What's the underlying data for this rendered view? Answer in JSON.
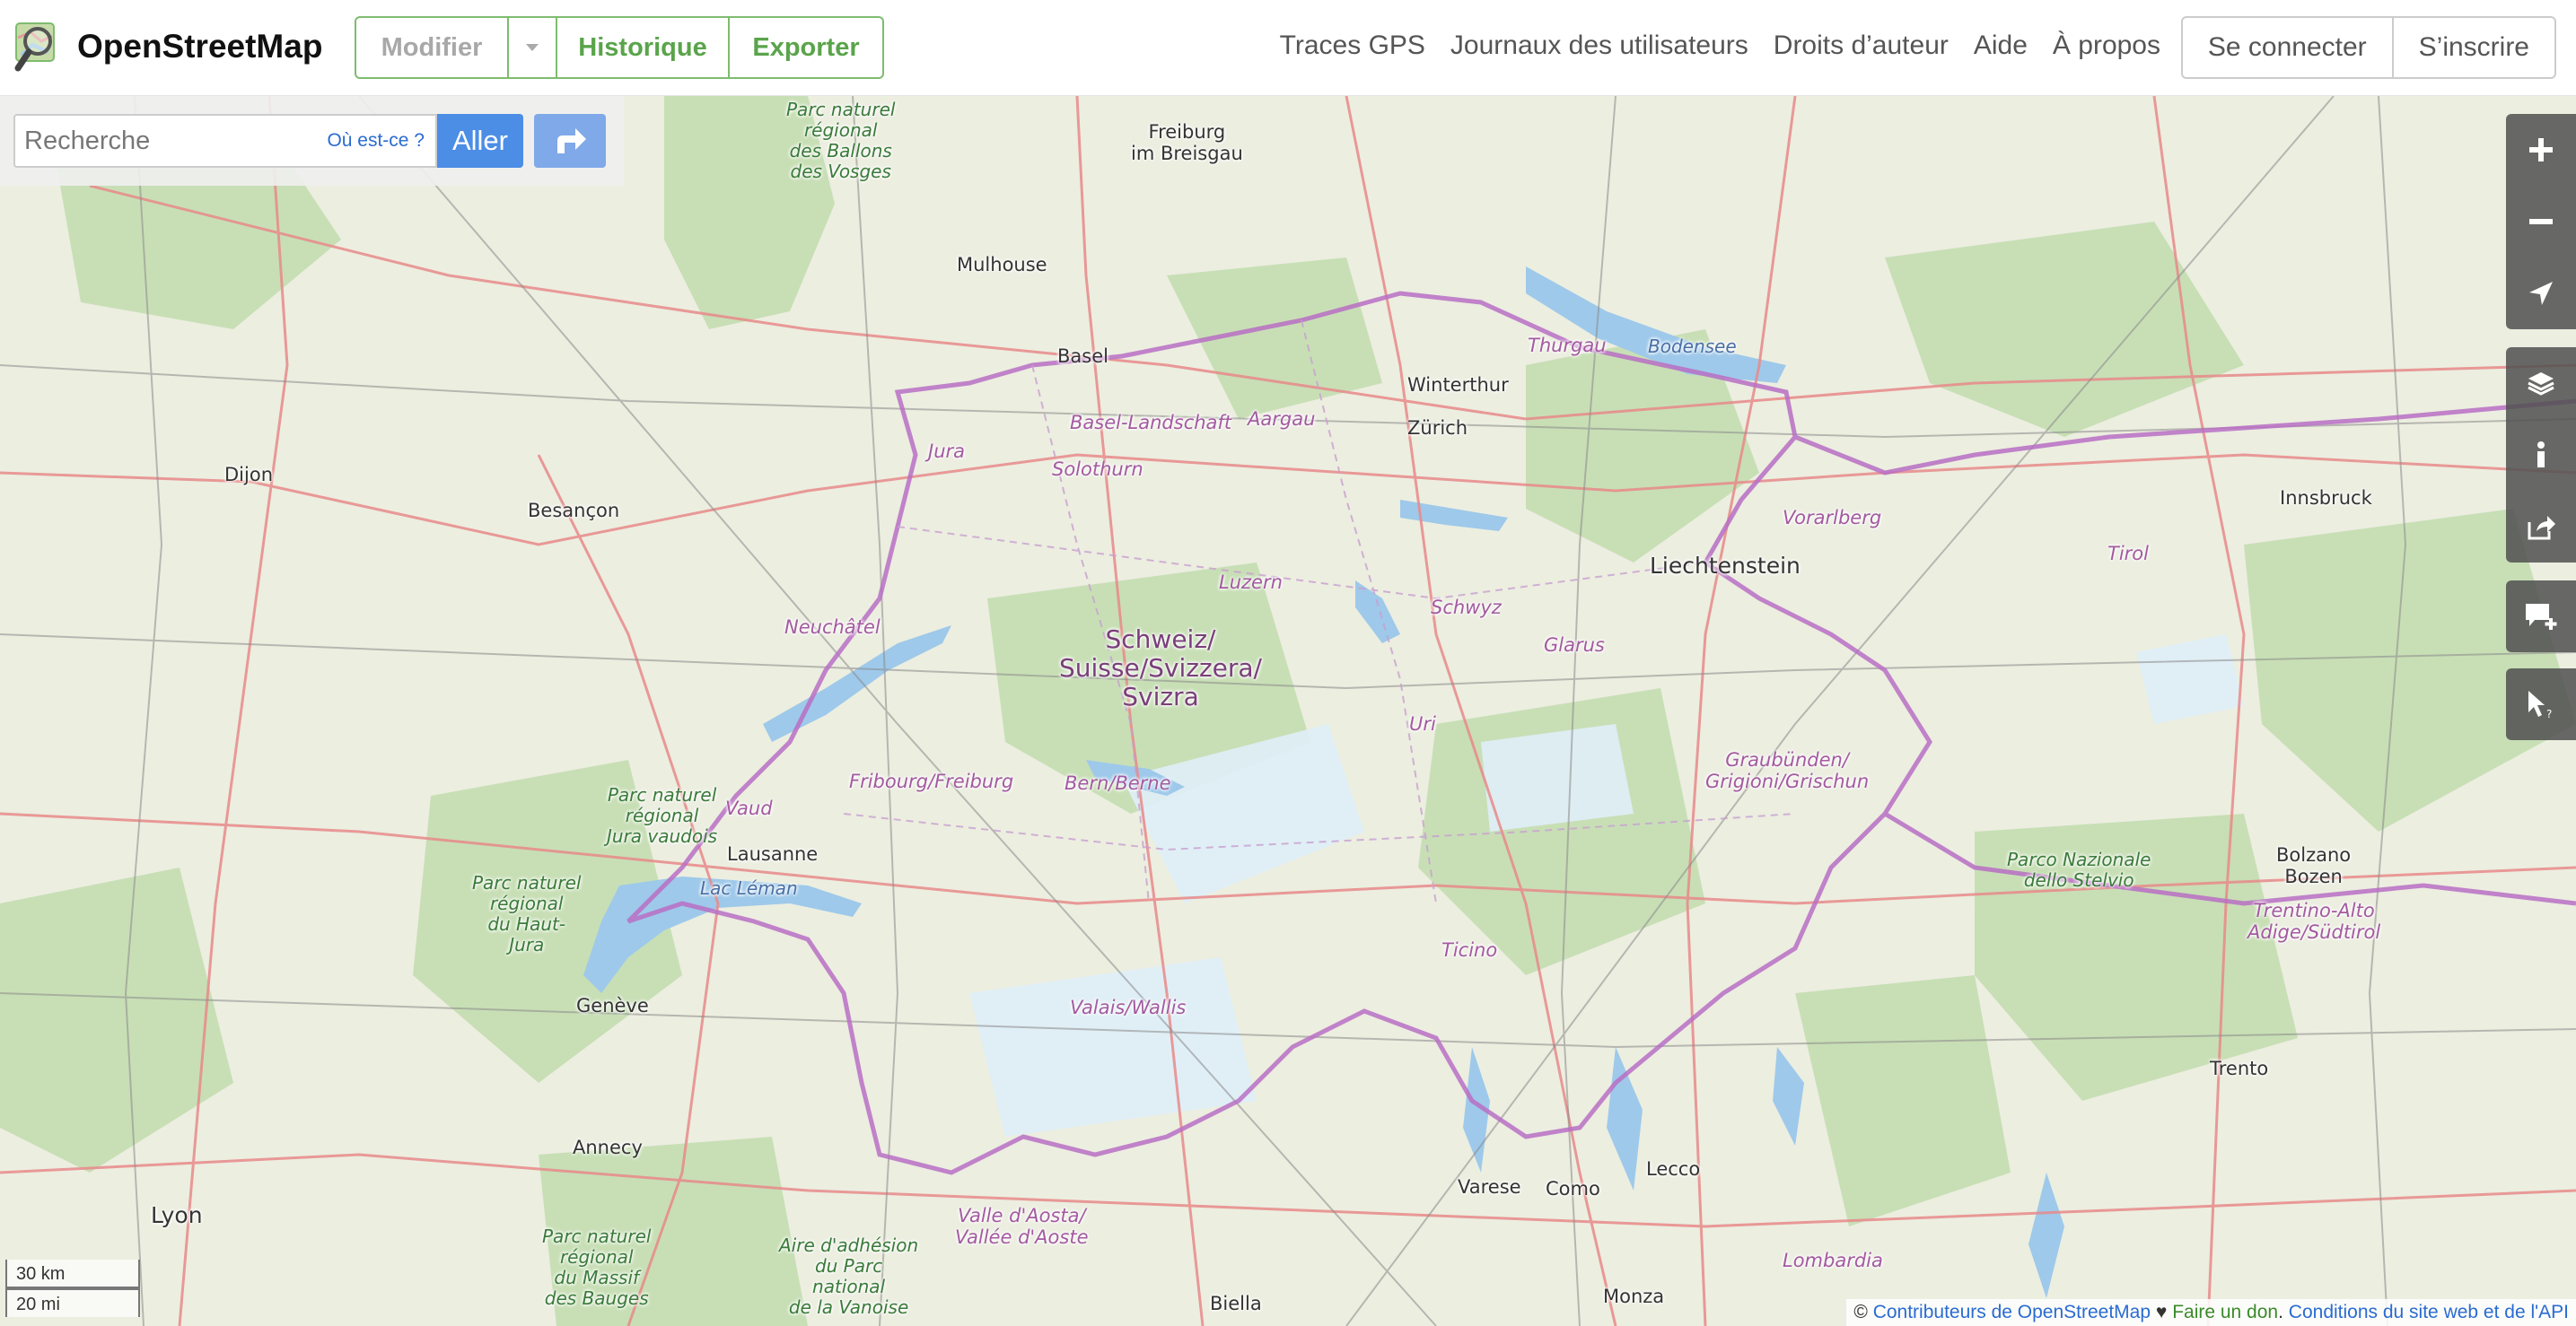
{
  "header": {
    "brand": "OpenStreetMap",
    "edit": {
      "modifier": "Modifier",
      "historique": "Historique",
      "exporter": "Exporter"
    },
    "nav": [
      "Traces GPS",
      "Journaux des utilisateurs",
      "Droits d’auteur",
      "Aide",
      "À propos"
    ],
    "auth": {
      "login": "Se connecter",
      "signup": "S’inscrire"
    }
  },
  "search": {
    "placeholder": "Recherche",
    "where_label": "Où est-ce ?",
    "go_label": "Aller"
  },
  "map": {
    "country_label": "Schweiz/\nSuisse/Svizzera/\nSvizra",
    "cities": {
      "freiburg": "Freiburg\nim Breisgau",
      "mulhouse": "Mulhouse",
      "basel": "Basel",
      "dijon": "Dijon",
      "besancon": "Besançon",
      "winterthur": "Winterthur",
      "zurich": "Zürich",
      "liechtenstein": "Liechtenstein",
      "innsbruck": "Innsbruck",
      "lausanne": "Lausanne",
      "geneve": "Genève",
      "annecy": "Annecy",
      "lyon": "Lyon",
      "varese": "Varese",
      "como": "Como",
      "lecco": "Lecco",
      "monza": "Monza",
      "biella": "Biella",
      "bolzano": "Bolzano\nBozen",
      "trento": "Trento"
    },
    "regions": {
      "thurgau": "Thurgau",
      "basel_landschaft": "Basel-Landschaft",
      "aargau": "Aargau",
      "jura": "Jura",
      "solothurn": "Solothurn",
      "luzern": "Luzern",
      "schwyz": "Schwyz",
      "glarus": "Glarus",
      "vorarlberg": "Vorarlberg",
      "tirol": "Tirol",
      "neuchatel": "Neuchâtel",
      "fribourg": "Fribourg/Freiburg",
      "bern": "Bern/Berne",
      "uri": "Uri",
      "vaud": "Vaud",
      "graubunden": "Graubünden/\nGrigioni/Grischun",
      "ticino": "Ticino",
      "valais": "Valais/Wallis",
      "valle_aosta": "Valle d'Aosta/\nVallée d'Aoste",
      "trentino": "Trentino-Alto\nAdige/Südtirol",
      "lombardia": "Lombardia"
    },
    "parks": {
      "ballons": "Parc naturel\nrégional\ndes Ballons\ndes Vosges",
      "jura_vaudois": "Parc naturel\nrégional\nJura vaudois",
      "haut_jura": "Parc naturel\nrégional\ndu Haut-\nJura",
      "bauges": "Parc naturel\nrégional\ndu Massif\ndes Bauges",
      "vanoise": "Aire d'adhésion\ndu Parc\nnational\nde la Vanoise",
      "stelvio": "Parco Nazionale\ndello Stelvio"
    },
    "lakes": {
      "bodensee": "Bodensee",
      "leman": "Lac Léman"
    }
  },
  "scale": {
    "metric": "30 km",
    "imperial": "20 mi"
  },
  "attribution": {
    "prefix": "©",
    "contributors": "Contributeurs de OpenStreetMap",
    "heart": "♥",
    "donate": "Faire un don",
    "sep": ".",
    "terms": "Conditions du site web et de l'API"
  },
  "colors": {
    "brand_green": "#7ebc6f",
    "link_blue": "#2a6bd1",
    "go_button": "#4c8ee6",
    "border_purple": "#b86fc4",
    "lake_blue": "#9ec9ea",
    "forest_green": "#b7d7a3"
  }
}
